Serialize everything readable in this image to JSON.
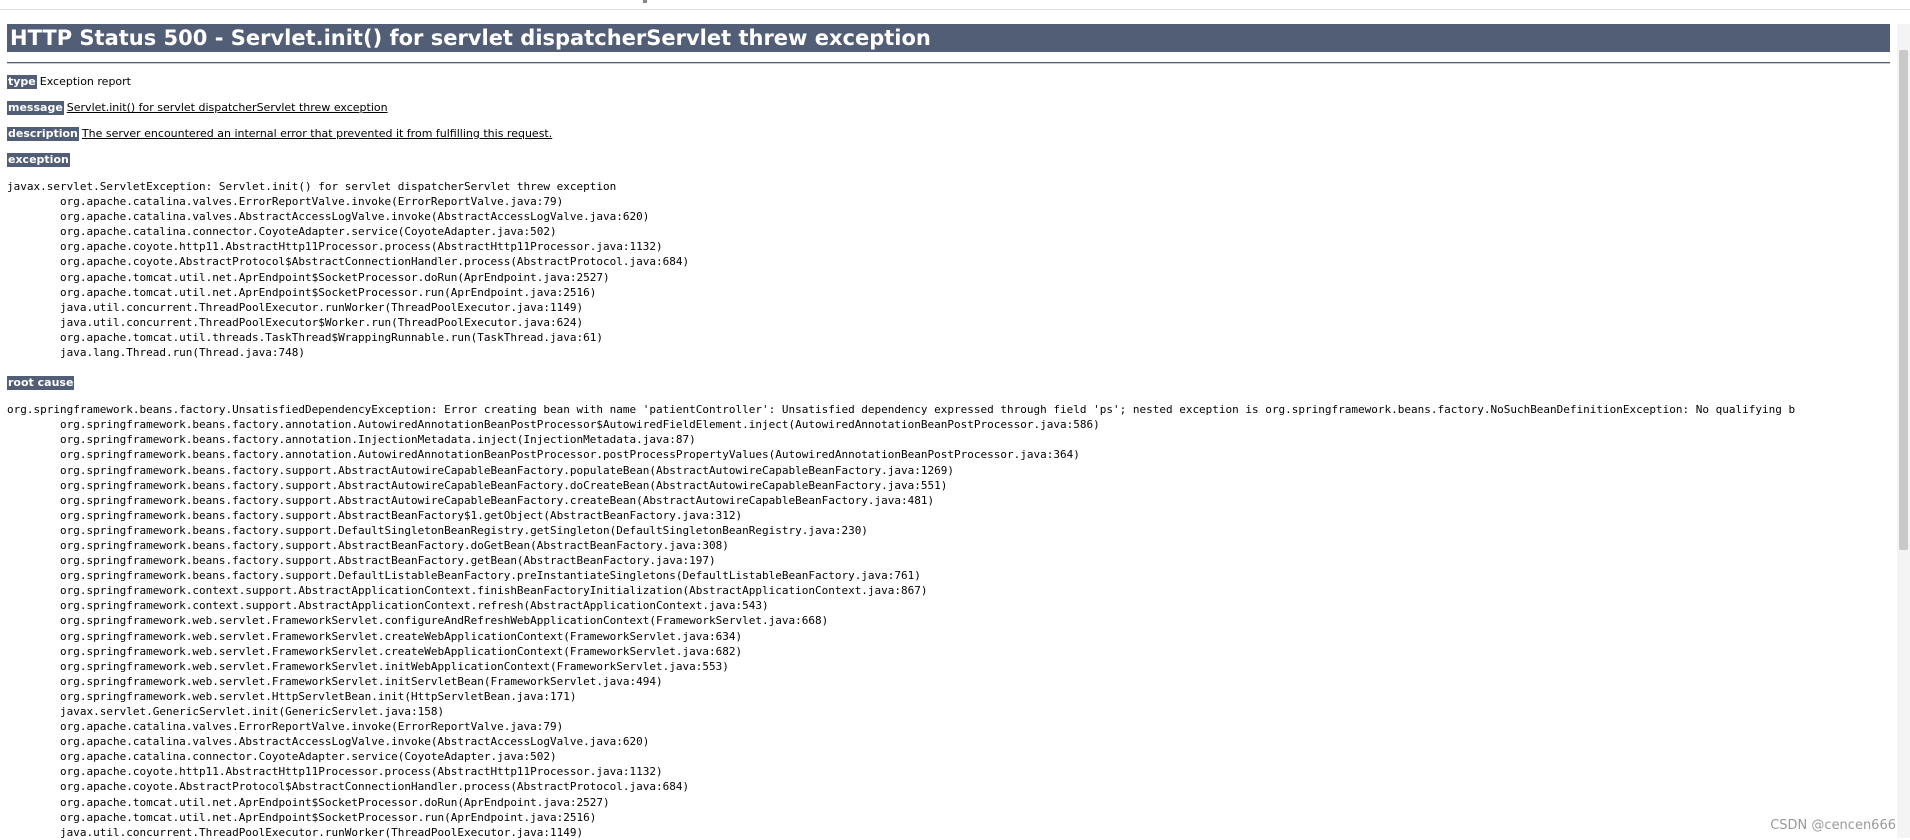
{
  "title": "HTTP Status 500 - Servlet.init() for servlet dispatcherServlet threw exception",
  "fields": {
    "type_label": "type",
    "type_value": "Exception report",
    "message_label": "message",
    "message_value": "Servlet.init() for servlet dispatcherServlet threw exception",
    "description_label": "description",
    "description_value": "The server encountered an internal error that prevented it from fulfilling this request.",
    "exception_label": "exception",
    "root_cause_label": "root cause"
  },
  "exception_trace": [
    "javax.servlet.ServletException: Servlet.init() for servlet dispatcherServlet threw exception",
    "\torg.apache.catalina.valves.ErrorReportValve.invoke(ErrorReportValve.java:79)",
    "\torg.apache.catalina.valves.AbstractAccessLogValve.invoke(AbstractAccessLogValve.java:620)",
    "\torg.apache.catalina.connector.CoyoteAdapter.service(CoyoteAdapter.java:502)",
    "\torg.apache.coyote.http11.AbstractHttp11Processor.process(AbstractHttp11Processor.java:1132)",
    "\torg.apache.coyote.AbstractProtocol$AbstractConnectionHandler.process(AbstractProtocol.java:684)",
    "\torg.apache.tomcat.util.net.AprEndpoint$SocketProcessor.doRun(AprEndpoint.java:2527)",
    "\torg.apache.tomcat.util.net.AprEndpoint$SocketProcessor.run(AprEndpoint.java:2516)",
    "\tjava.util.concurrent.ThreadPoolExecutor.runWorker(ThreadPoolExecutor.java:1149)",
    "\tjava.util.concurrent.ThreadPoolExecutor$Worker.run(ThreadPoolExecutor.java:624)",
    "\torg.apache.tomcat.util.threads.TaskThread$WrappingRunnable.run(TaskThread.java:61)",
    "\tjava.lang.Thread.run(Thread.java:748)"
  ],
  "root_cause_trace": [
    "org.springframework.beans.factory.UnsatisfiedDependencyException: Error creating bean with name 'patientController': Unsatisfied dependency expressed through field 'ps'; nested exception is org.springframework.beans.factory.NoSuchBeanDefinitionException: No qualifying b",
    "\torg.springframework.beans.factory.annotation.AutowiredAnnotationBeanPostProcessor$AutowiredFieldElement.inject(AutowiredAnnotationBeanPostProcessor.java:586)",
    "\torg.springframework.beans.factory.annotation.InjectionMetadata.inject(InjectionMetadata.java:87)",
    "\torg.springframework.beans.factory.annotation.AutowiredAnnotationBeanPostProcessor.postProcessPropertyValues(AutowiredAnnotationBeanPostProcessor.java:364)",
    "\torg.springframework.beans.factory.support.AbstractAutowireCapableBeanFactory.populateBean(AbstractAutowireCapableBeanFactory.java:1269)",
    "\torg.springframework.beans.factory.support.AbstractAutowireCapableBeanFactory.doCreateBean(AbstractAutowireCapableBeanFactory.java:551)",
    "\torg.springframework.beans.factory.support.AbstractAutowireCapableBeanFactory.createBean(AbstractAutowireCapableBeanFactory.java:481)",
    "\torg.springframework.beans.factory.support.AbstractBeanFactory$1.getObject(AbstractBeanFactory.java:312)",
    "\torg.springframework.beans.factory.support.DefaultSingletonBeanRegistry.getSingleton(DefaultSingletonBeanRegistry.java:230)",
    "\torg.springframework.beans.factory.support.AbstractBeanFactory.doGetBean(AbstractBeanFactory.java:308)",
    "\torg.springframework.beans.factory.support.AbstractBeanFactory.getBean(AbstractBeanFactory.java:197)",
    "\torg.springframework.beans.factory.support.DefaultListableBeanFactory.preInstantiateSingletons(DefaultListableBeanFactory.java:761)",
    "\torg.springframework.context.support.AbstractApplicationContext.finishBeanFactoryInitialization(AbstractApplicationContext.java:867)",
    "\torg.springframework.context.support.AbstractApplicationContext.refresh(AbstractApplicationContext.java:543)",
    "\torg.springframework.web.servlet.FrameworkServlet.configureAndRefreshWebApplicationContext(FrameworkServlet.java:668)",
    "\torg.springframework.web.servlet.FrameworkServlet.createWebApplicationContext(FrameworkServlet.java:634)",
    "\torg.springframework.web.servlet.FrameworkServlet.createWebApplicationContext(FrameworkServlet.java:682)",
    "\torg.springframework.web.servlet.FrameworkServlet.initWebApplicationContext(FrameworkServlet.java:553)",
    "\torg.springframework.web.servlet.FrameworkServlet.initServletBean(FrameworkServlet.java:494)",
    "\torg.springframework.web.servlet.HttpServletBean.init(HttpServletBean.java:171)",
    "\tjavax.servlet.GenericServlet.init(GenericServlet.java:158)",
    "\torg.apache.catalina.valves.ErrorReportValve.invoke(ErrorReportValve.java:79)",
    "\torg.apache.catalina.valves.AbstractAccessLogValve.invoke(AbstractAccessLogValve.java:620)",
    "\torg.apache.catalina.connector.CoyoteAdapter.service(CoyoteAdapter.java:502)",
    "\torg.apache.coyote.http11.AbstractHttp11Processor.process(AbstractHttp11Processor.java:1132)",
    "\torg.apache.coyote.AbstractProtocol$AbstractConnectionHandler.process(AbstractProtocol.java:684)",
    "\torg.apache.tomcat.util.net.AprEndpoint$SocketProcessor.doRun(AprEndpoint.java:2527)",
    "\torg.apache.tomcat.util.net.AprEndpoint$SocketProcessor.run(AprEndpoint.java:2516)",
    "\tjava.util.concurrent.ThreadPoolExecutor.runWorker(ThreadPoolExecutor.java:1149)"
  ],
  "watermark": "CSDN @cencen666",
  "colors": {
    "header_bg": "#525d76",
    "header_text": "#ffffff",
    "body_text": "#000000",
    "watermark": "#9a9a9a"
  }
}
